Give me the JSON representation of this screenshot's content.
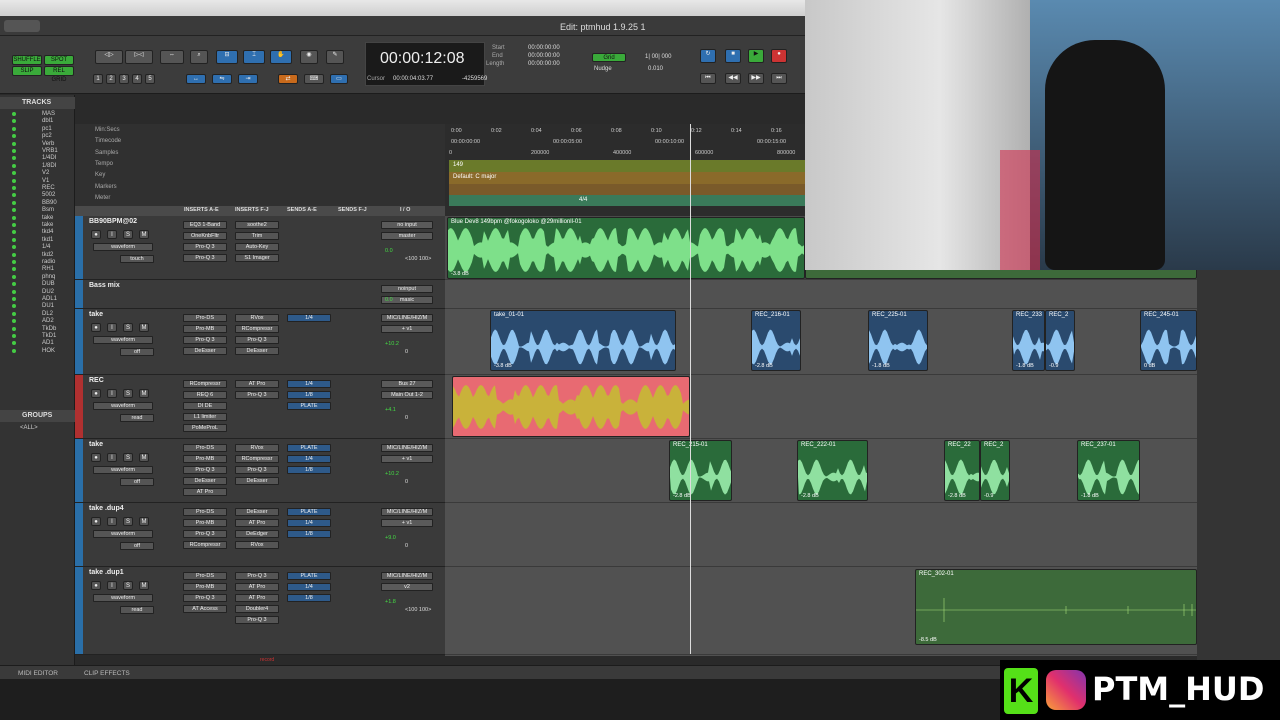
{
  "window": {
    "title": "Edit: ptmhud 1.9.25 1"
  },
  "toolbar": {
    "modes": [
      "SHUFFLE",
      "SPOT",
      "SLIP",
      "REL GRID"
    ],
    "counter_main": "00:00:12:08",
    "start_label": "Start",
    "end_label": "End",
    "length_label": "Length",
    "start": "00:00:00:00",
    "end": "00:00:00:00",
    "length": "00:00:00:00",
    "cursor_label": "Cursor",
    "cursor": "00:00:04:03.77",
    "sample": "-4259569",
    "grid_label": "Grid",
    "grid_value": "1| 00| 000",
    "nudge_label": "Nudge",
    "nudge_value": "0.010"
  },
  "tracks_panel": {
    "title": "TRACKS",
    "groups_title": "GROUPS",
    "groups_all": "<ALL>",
    "items": [
      "MAS",
      "dbl1",
      "pc1",
      "pc2",
      "Verb",
      "VRB1",
      "1/4DI",
      "1/8DI",
      "V2",
      "V1",
      "REC",
      "5002",
      "BB90",
      "Bsm",
      "take",
      "take",
      "tkd4",
      "tkd1",
      "1/4",
      "tkd2",
      "radio",
      "RH1",
      "phnq",
      "DUB",
      "DU2",
      "ADL1",
      "DU1",
      "DL2",
      "AD2",
      "TkDb",
      "TkD1",
      "AD1",
      "HOK"
    ]
  },
  "rulers": [
    "Min:Secs",
    "Timecode",
    "Samples",
    "Tempo",
    "Key",
    "Markers",
    "Meter"
  ],
  "timeline": {
    "minsecs": [
      "0:00",
      "0:02",
      "0:04",
      "0:06",
      "0:08",
      "0:10",
      "0:12",
      "0:14",
      "0:16"
    ],
    "timecode": [
      "00:00:00:00",
      "00:00:05:00",
      "00:00:10:00",
      "00:00:15:00"
    ],
    "samples": [
      "0",
      "200000",
      "400000",
      "600000",
      "800000"
    ],
    "tempo": "149",
    "key": "Default: C major",
    "meter": "4/4"
  },
  "column_headers": [
    "INSERTS A-E",
    "INSERTS F-J",
    "SENDS A-E",
    "SENDS F-J",
    "I / O"
  ],
  "tracks": [
    {
      "name": "BB90BPM@02",
      "inserts1": [
        "EQ3 1-Band",
        "OneKnbFltr",
        "Pro-Q 3",
        "Pro-Q 3"
      ],
      "inserts2": [
        "soothe2",
        "Trim",
        "Auto-Key",
        "S1 Imager"
      ],
      "io": [
        "no input",
        "master"
      ],
      "vol": "0.0",
      "pan": "<100 100>",
      "view": "waveform",
      "auto": "touch"
    },
    {
      "name": "Bass mix",
      "io": [
        "noinput",
        "masic"
      ],
      "vol": "0.0"
    },
    {
      "name": "take",
      "inserts1": [
        "Pro-DS",
        "Pro-MB",
        "Pro-Q 3",
        "DeEsser"
      ],
      "inserts2": [
        "RVox",
        "RCompressr",
        "Pro-Q 3",
        "DeEsser"
      ],
      "sends": [
        "1/4"
      ],
      "io": [
        "MIC/LINE/HIZ/M",
        "+ v1"
      ],
      "vol": "+10.2",
      "pan": "0",
      "view": "waveform",
      "auto": "off"
    },
    {
      "name": "REC",
      "inserts1": [
        "RCompressr",
        "REQ 6",
        "DI DE",
        "L1 limiter",
        "PoMeProL"
      ],
      "inserts2": [
        "AT Pro",
        "Pro-Q 3"
      ],
      "sends": [
        "1/4",
        "1/8",
        "PLATE"
      ],
      "io": [
        "Bus 27",
        "Main Out 1-2"
      ],
      "vol": "+4.1",
      "pan": "0",
      "view": "waveform",
      "auto": "read"
    },
    {
      "name": "take",
      "inserts1": [
        "Pro-DS",
        "Pro-MB",
        "Pro-Q 3",
        "DeEsser",
        "AT Pro"
      ],
      "inserts2": [
        "RVox",
        "RCompressr",
        "Pro-Q 3",
        "DeEsser"
      ],
      "sends": [
        "PLATE",
        "1/4",
        "1/8"
      ],
      "io": [
        "MIC/LINE/HIZ/M",
        "+ v1"
      ],
      "vol": "+10.2",
      "pan": "0",
      "view": "waveform",
      "auto": "off"
    },
    {
      "name": "take .dup4",
      "inserts1": [
        "Pro-DS",
        "Pro-MB",
        "Pro-Q 3",
        "RCompressr"
      ],
      "inserts2": [
        "DeEsser",
        "AT Pro",
        "DeEdger",
        "RVox"
      ],
      "sends": [
        "PLATE",
        "1/4",
        "1/8"
      ],
      "io": [
        "MIC/LINE/HIZ/M",
        "+ v1"
      ],
      "vol": "+9.0",
      "pan": "0",
      "view": "waveform",
      "auto": "off"
    },
    {
      "name": "take .dup1",
      "inserts1": [
        "Pro-DS",
        "Pro-MB",
        "Pro-Q 3",
        "AT Access"
      ],
      "inserts2": [
        "Pro-Q 3",
        "AT Pro",
        "AT Pro",
        "Doubler4",
        "Pro-Q 3"
      ],
      "sends": [
        "PLATE",
        "1/4",
        "1/8"
      ],
      "io": [
        "MIC/LINE/HIZ/M",
        "v2"
      ],
      "vol": "+1.8",
      "pan": "<100 100>",
      "view": "waveform",
      "auto": "read"
    }
  ],
  "clips": {
    "beat": {
      "name": "Blue Dev8 149bpm @fokogoloko @29millionll-01",
      "gain": "-3.8 dB"
    },
    "take1": [
      {
        "name": "take_01-01",
        "gain": "-3.8 dB"
      },
      {
        "name": "REC_216-01",
        "gain": "-2.8 dB"
      },
      {
        "name": "REC_225-01",
        "gain": "-1.8 dB"
      },
      {
        "name": "REC_233",
        "gain": "-1.8 dB"
      },
      {
        "name": "REC_2",
        "gain": "-0.9"
      },
      {
        "name": "REC_245-01",
        "gain": "0 dB"
      }
    ],
    "take2": [
      {
        "name": "REC_215-01",
        "gain": "-2.8 dB"
      },
      {
        "name": "REC_222-01",
        "gain": "-2.8 dB"
      },
      {
        "name": "REC_22",
        "gain": "-2.8 dB"
      },
      {
        "name": "REC_2",
        "gain": "-0.9"
      },
      {
        "name": "REC_237-01",
        "gain": "-1.8 dB"
      }
    ],
    "dup1": {
      "name": "REC_302-01",
      "gain": "-8.5 dB"
    }
  },
  "bottom": {
    "midi_editor": "MIDI EDITOR",
    "clip_effects": "CLIP EFFECTS",
    "record": "record"
  },
  "logo": {
    "text": "PTM_HUD"
  }
}
